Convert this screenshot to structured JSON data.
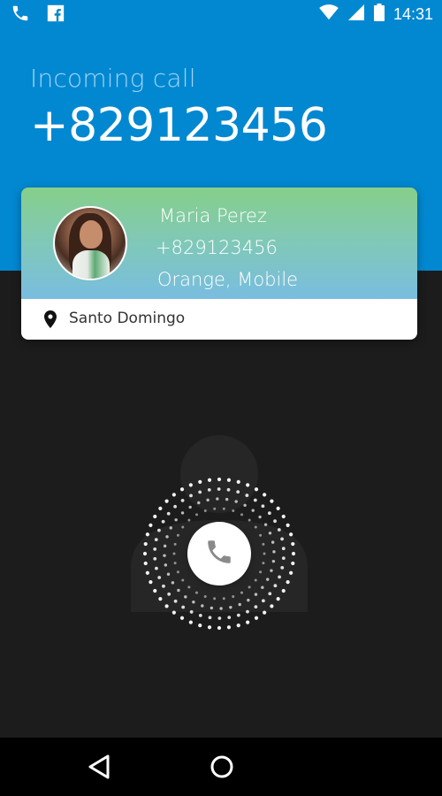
{
  "status_bar": {
    "time": "14:31",
    "icons": [
      "phone-icon",
      "facebook-icon",
      "wifi-icon",
      "signal-icon",
      "battery-icon"
    ]
  },
  "call": {
    "label": "Incoming call",
    "number": "+829123456"
  },
  "contact": {
    "name": "Maria Perez",
    "number": "+829123456",
    "carrier": "Orange, Mobile",
    "location": "Santo Domingo"
  },
  "controls": {
    "answer_icon": "phone-icon"
  },
  "nav": {
    "icons": [
      "back-icon",
      "home-icon"
    ]
  },
  "colors": {
    "header_blue": "#0288d1",
    "background_dark": "#1c1c1c",
    "card_gradient_top": "#86cf8a",
    "card_gradient_bottom": "#79bde0"
  }
}
